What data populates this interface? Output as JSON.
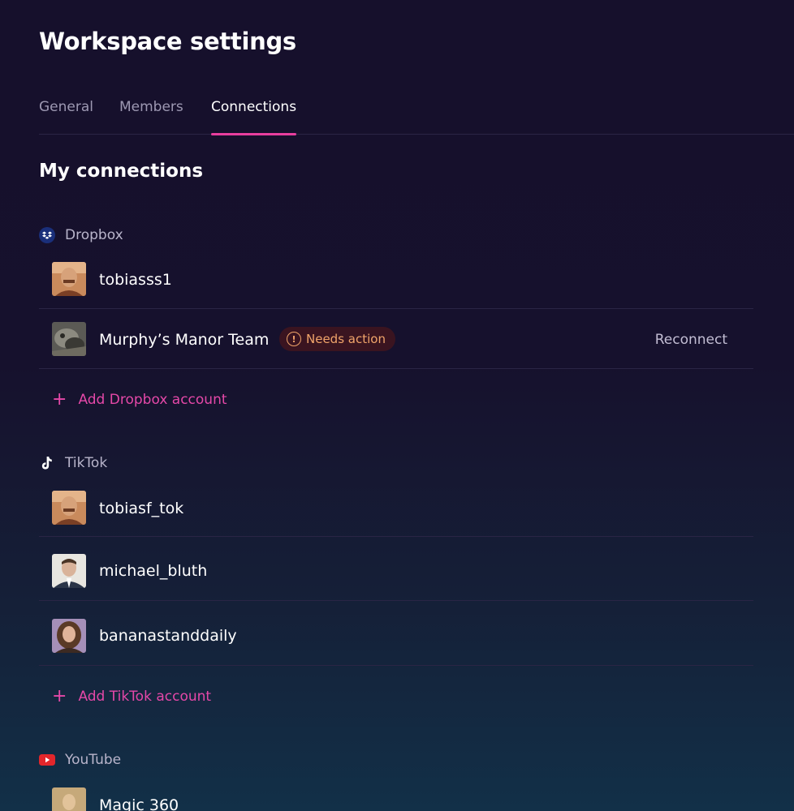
{
  "page": {
    "title": "Workspace settings"
  },
  "tabs": [
    {
      "label": "General",
      "active": false
    },
    {
      "label": "Members",
      "active": false
    },
    {
      "label": "Connections",
      "active": true
    }
  ],
  "section": {
    "title": "My connections"
  },
  "dropbox": {
    "label": "Dropbox",
    "icon": "dropbox-icon",
    "accounts": [
      {
        "name": "tobiasss1"
      },
      {
        "name": "Murphy’s Manor Team",
        "badge": "Needs action",
        "action": "Reconnect"
      }
    ],
    "add_label": "Add Dropbox account"
  },
  "tiktok": {
    "label": "TikTok",
    "icon": "tiktok-icon",
    "accounts": [
      {
        "name": "tobiasf_tok"
      },
      {
        "name": "michael_bluth"
      },
      {
        "name": "bananastanddaily"
      }
    ],
    "add_label": "Add TikTok account"
  },
  "youtube": {
    "label": "YouTube",
    "icon": "youtube-icon",
    "accounts": [
      {
        "name": "Magic 360"
      }
    ]
  },
  "colors": {
    "accent": "#e83e9f",
    "warning": "#f0a46a",
    "background": "#16112d"
  }
}
